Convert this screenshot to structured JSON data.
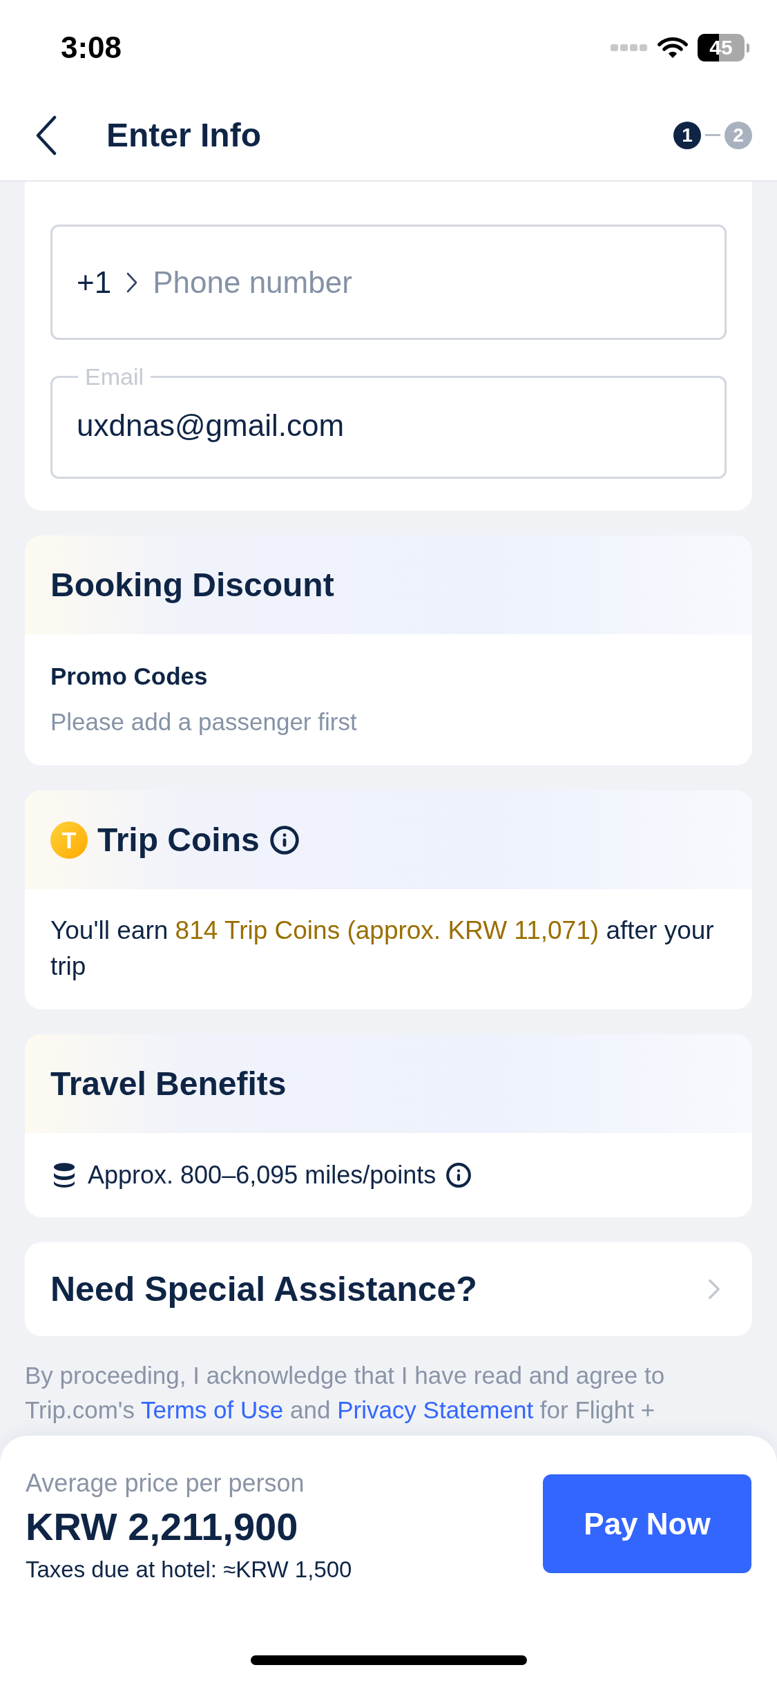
{
  "status_bar": {
    "time": "3:08",
    "battery": "45"
  },
  "header": {
    "title": "Enter Info",
    "steps": [
      {
        "label": "1",
        "active": true
      },
      {
        "label": "2",
        "active": false
      }
    ]
  },
  "contact": {
    "phone": {
      "country_code": "+1",
      "placeholder": "Phone number"
    },
    "email": {
      "label": "Email",
      "value": "uxdnas@gmail.com"
    }
  },
  "booking_discount": {
    "title": "Booking Discount",
    "promo_label": "Promo Codes",
    "promo_hint": "Please add a passenger first"
  },
  "trip_coins": {
    "title": "Trip Coins",
    "coin_symbol": "T",
    "message": {
      "before": "You'll earn ",
      "highlight": "814 Trip Coins (approx. KRW 11,071)",
      "after": " after your trip"
    }
  },
  "travel_benefits": {
    "title": "Travel Benefits",
    "miles": "Approx. 800–6,095 miles/points"
  },
  "special_assistance": {
    "title": "Need Special Assistance?"
  },
  "legal": [
    {
      "kind": "text",
      "text": "By proceeding, I acknowledge that I have read and agree to Trip.com's "
    },
    {
      "kind": "link",
      "text": "Terms of Use"
    },
    {
      "kind": "text",
      "text": " and "
    },
    {
      "kind": "link",
      "text": "Privacy Statement"
    },
    {
      "kind": "text",
      "text": " for Flight +"
    }
  ],
  "footer": {
    "price_label": "Average price per person",
    "price": "KRW 2,211,900",
    "taxes": "Taxes due at hotel: ≈KRW 1,500",
    "pay_button": "Pay Now"
  }
}
